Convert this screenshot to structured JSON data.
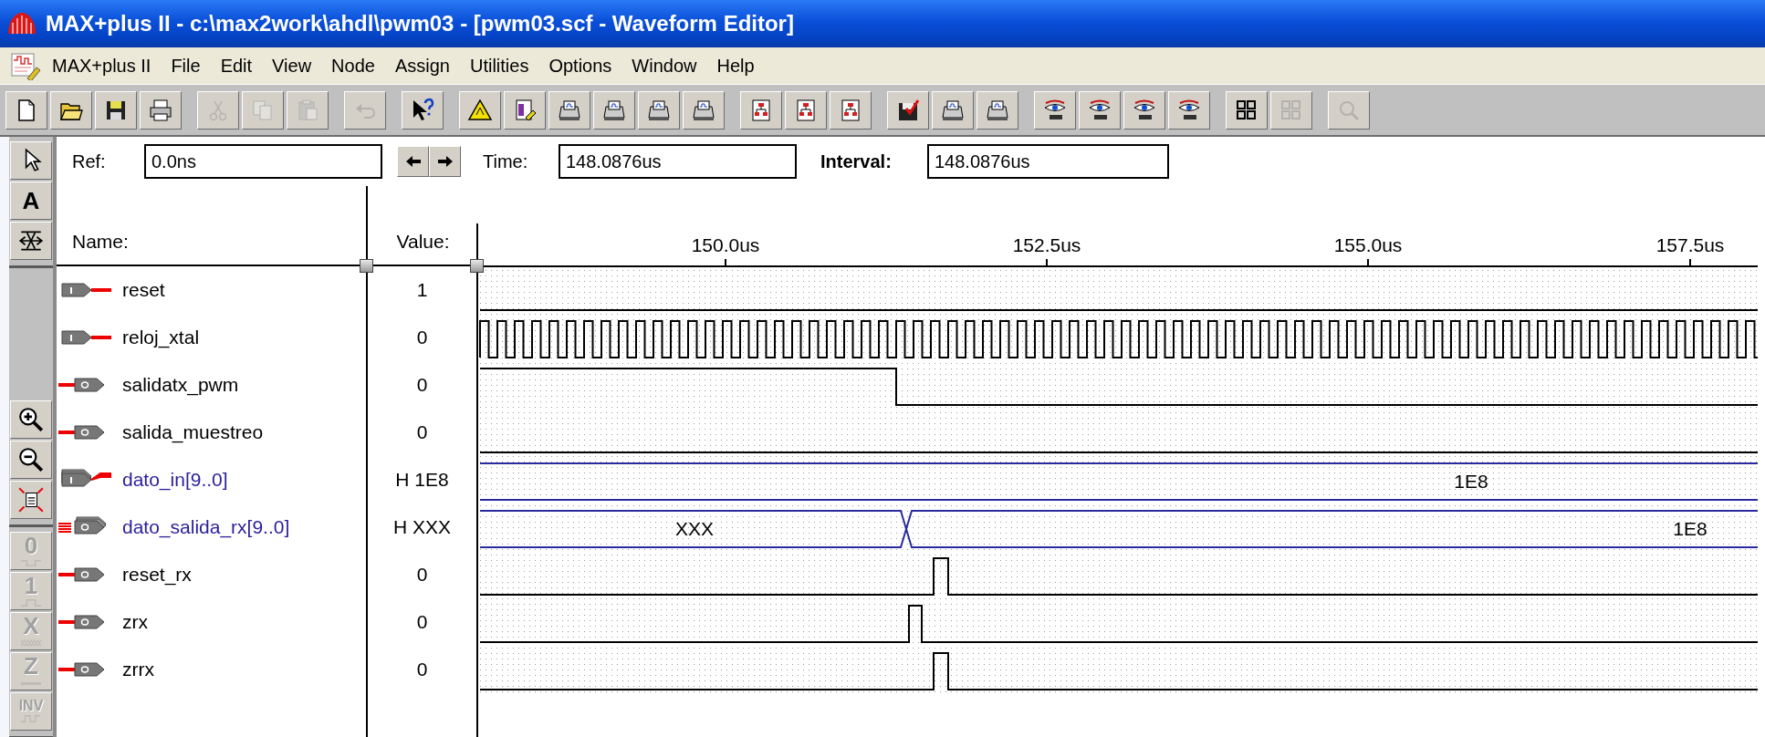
{
  "window": {
    "title": "MAX+plus II - c:\\max2work\\ahdl\\pwm03 - [pwm03.scf - Waveform Editor]"
  },
  "menu": [
    "MAX+plus II",
    "File",
    "Edit",
    "View",
    "Node",
    "Assign",
    "Utilities",
    "Options",
    "Window",
    "Help"
  ],
  "toolbar": [
    {
      "buttons": [
        {
          "disabled": false
        },
        {
          "disabled": false
        },
        {
          "disabled": false
        },
        {
          "disabled": false
        }
      ]
    },
    {
      "buttons": [
        {
          "disabled": true
        },
        {
          "disabled": true
        },
        {
          "disabled": true
        }
      ]
    },
    {
      "buttons": [
        {
          "disabled": true
        }
      ]
    },
    {
      "buttons": [
        {
          "disabled": false
        }
      ]
    },
    {
      "buttons": [
        {
          "disabled": false
        },
        {
          "disabled": false
        },
        {
          "disabled": false
        },
        {
          "disabled": false
        },
        {
          "disabled": false
        },
        {
          "disabled": false
        }
      ]
    },
    {
      "buttons": [
        {
          "disabled": false
        },
        {
          "disabled": false
        },
        {
          "disabled": false
        }
      ]
    },
    {
      "buttons": [
        {
          "disabled": false
        },
        {
          "disabled": false
        },
        {
          "disabled": false
        }
      ]
    },
    {
      "buttons": [
        {
          "disabled": false
        },
        {
          "disabled": false
        },
        {
          "disabled": false
        },
        {
          "disabled": false
        }
      ]
    },
    {
      "buttons": [
        {
          "disabled": false
        },
        {
          "disabled": true
        }
      ]
    },
    {
      "buttons": [
        {
          "disabled": true
        }
      ]
    }
  ],
  "palette": [
    {
      "tools": [
        {
          "kind": "pointer",
          "disabled": false
        },
        {
          "kind": "text",
          "label": "A",
          "disabled": false
        },
        {
          "kind": "expand",
          "disabled": false
        }
      ]
    },
    {
      "tools": [
        {
          "kind": "zoom-in",
          "disabled": false
        },
        {
          "kind": "zoom-out",
          "disabled": false
        },
        {
          "kind": "fit",
          "disabled": false
        }
      ]
    },
    {
      "tools": [
        {
          "kind": "low",
          "label": "0",
          "disabled": true
        },
        {
          "kind": "high",
          "label": "1",
          "disabled": true
        },
        {
          "kind": "unknown",
          "label": "X",
          "disabled": true
        },
        {
          "kind": "z",
          "label": "Z",
          "disabled": true
        },
        {
          "kind": "invert",
          "label": "INV",
          "disabled": true
        }
      ]
    }
  ],
  "cursor": {
    "ref_label": "Ref:",
    "ref": "0.0ns",
    "time_label": "Time:",
    "time": "148.0876us",
    "interval_label": "Interval:",
    "interval": "148.0876us"
  },
  "columns": {
    "name": "Name:",
    "value": "Value:"
  },
  "ticks": [
    "150.0us",
    "152.5us",
    "155.0us",
    "157.5us"
  ],
  "signals": [
    {
      "name": "reset",
      "pin": {
        "kind": "input",
        "bus": false
      },
      "value": "1",
      "wave": {
        "kind": "low"
      }
    },
    {
      "name": "reloj_xtal",
      "pin": {
        "kind": "input",
        "bus": false
      },
      "value": "0",
      "wave": {
        "kind": "clock"
      }
    },
    {
      "name": "salidatx_pwm",
      "pin": {
        "kind": "output",
        "bus": false
      },
      "value": "0",
      "wave": {
        "kind": "fall"
      }
    },
    {
      "name": "salida_muestreo",
      "pin": {
        "kind": "output",
        "bus": false
      },
      "value": "0",
      "wave": {
        "kind": "low"
      }
    },
    {
      "name": "dato_in[9..0]",
      "pin": {
        "kind": "input",
        "bus": true
      },
      "value": "H 1E8",
      "wave": {
        "kind": "bus",
        "labels": [
          "1E8"
        ]
      }
    },
    {
      "name": "dato_salida_rx[9..0]",
      "pin": {
        "kind": "output",
        "bus": true
      },
      "value": "H XXX",
      "wave": {
        "kind": "bus-change",
        "labels": [
          "XXX",
          "1E8"
        ]
      }
    },
    {
      "name": "reset_rx",
      "pin": {
        "kind": "output",
        "bus": false
      },
      "value": "0",
      "wave": {
        "kind": "pulse-late"
      }
    },
    {
      "name": "zrx",
      "pin": {
        "kind": "output",
        "bus": false
      },
      "value": "0",
      "wave": {
        "kind": "pulse-early"
      }
    },
    {
      "name": "zrrx",
      "pin": {
        "kind": "output",
        "bus": false
      },
      "value": "0",
      "wave": {
        "kind": "pulse-late"
      }
    }
  ]
}
